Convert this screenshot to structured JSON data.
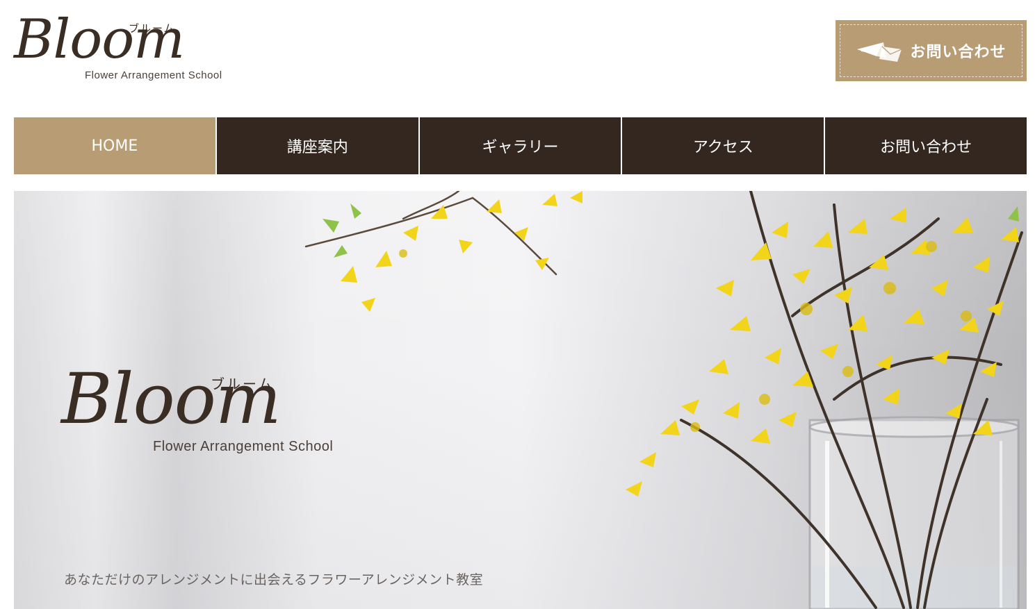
{
  "header": {
    "logo": {
      "script": "Bloom",
      "kana": "ブルーム",
      "subtitle": "Flower Arrangement School"
    },
    "contact_button": {
      "label": "お問い合わせ",
      "icon": "paper-plane-icon"
    }
  },
  "nav": {
    "items": [
      {
        "label": "HOME",
        "active": true
      },
      {
        "label": "講座案内",
        "active": false
      },
      {
        "label": "ギャラリー",
        "active": false
      },
      {
        "label": "アクセス",
        "active": false
      },
      {
        "label": "お問い合わせ",
        "active": false
      }
    ]
  },
  "hero": {
    "logo": {
      "script": "Bloom",
      "kana": "ブルーム",
      "subtitle": "Flower Arrangement School"
    },
    "tagline": "あなただけのアレンジメントに出会えるフラワーアレンジメント教室"
  },
  "colors": {
    "accent": "#b89c73",
    "nav_background": "#33271f",
    "text_dark": "#3a2d24",
    "flower_yellow": "#f2d41a"
  }
}
